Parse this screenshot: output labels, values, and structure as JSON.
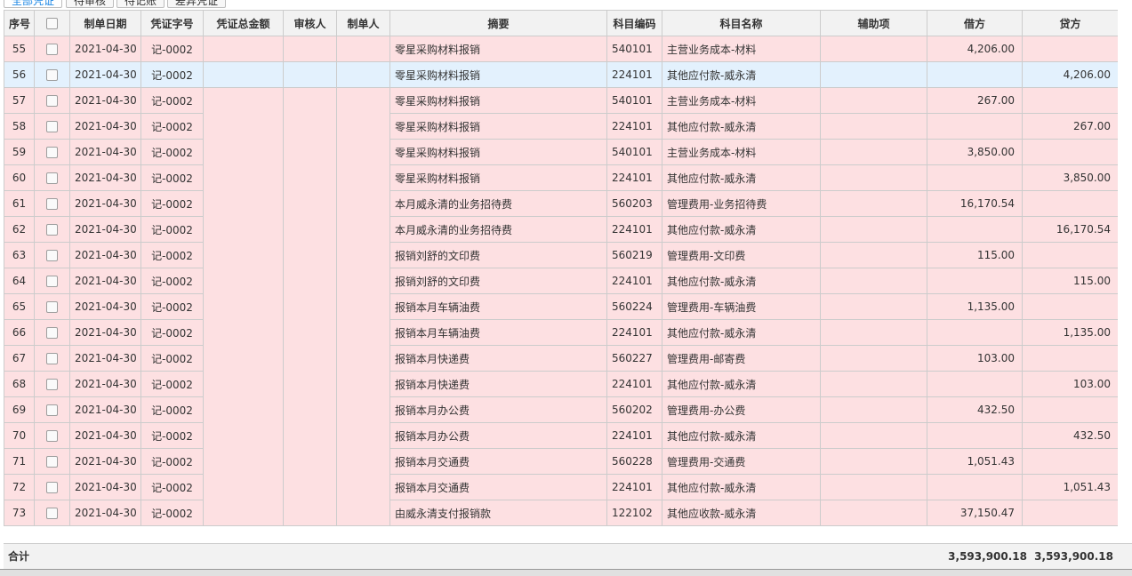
{
  "tabs": [
    "全部凭证",
    "待审核",
    "待记账",
    "差异凭证"
  ],
  "columns": {
    "seq": "序号",
    "date": "制单日期",
    "voucher_no": "凭证字号",
    "total": "凭证总金额",
    "reviewer": "审核人",
    "maker": "制单人",
    "summary": "摘要",
    "account_code": "科目编码",
    "account_name": "科目名称",
    "aux": "辅助项",
    "debit": "借方",
    "credit": "贷方"
  },
  "rows": [
    {
      "seq": "55",
      "date": "2021-04-30",
      "voucher": "记-0002",
      "summary": "零星采购材料报销",
      "code": "540101",
      "name": "主营业务成本-材料",
      "debit": "4,206.00",
      "credit": ""
    },
    {
      "seq": "56",
      "date": "2021-04-30",
      "voucher": "记-0002",
      "summary": "零星采购材料报销",
      "code": "224101",
      "name": "其他应付款-威永清",
      "debit": "",
      "credit": "4,206.00"
    },
    {
      "seq": "57",
      "date": "2021-04-30",
      "voucher": "记-0002",
      "summary": "零星采购材料报销",
      "code": "540101",
      "name": "主营业务成本-材料",
      "debit": "267.00",
      "credit": ""
    },
    {
      "seq": "58",
      "date": "2021-04-30",
      "voucher": "记-0002",
      "summary": "零星采购材料报销",
      "code": "224101",
      "name": "其他应付款-威永清",
      "debit": "",
      "credit": "267.00"
    },
    {
      "seq": "59",
      "date": "2021-04-30",
      "voucher": "记-0002",
      "summary": "零星采购材料报销",
      "code": "540101",
      "name": "主营业务成本-材料",
      "debit": "3,850.00",
      "credit": ""
    },
    {
      "seq": "60",
      "date": "2021-04-30",
      "voucher": "记-0002",
      "summary": "零星采购材料报销",
      "code": "224101",
      "name": "其他应付款-威永清",
      "debit": "",
      "credit": "3,850.00"
    },
    {
      "seq": "61",
      "date": "2021-04-30",
      "voucher": "记-0002",
      "summary": "本月威永清的业务招待费",
      "code": "560203",
      "name": "管理费用-业务招待费",
      "debit": "16,170.54",
      "credit": ""
    },
    {
      "seq": "62",
      "date": "2021-04-30",
      "voucher": "记-0002",
      "summary": "本月威永清的业务招待费",
      "code": "224101",
      "name": "其他应付款-威永清",
      "debit": "",
      "credit": "16,170.54"
    },
    {
      "seq": "63",
      "date": "2021-04-30",
      "voucher": "记-0002",
      "summary": "报销刘舒的文印费",
      "code": "560219",
      "name": "管理费用-文印费",
      "debit": "115.00",
      "credit": ""
    },
    {
      "seq": "64",
      "date": "2021-04-30",
      "voucher": "记-0002",
      "summary": "报销刘舒的文印费",
      "code": "224101",
      "name": "其他应付款-威永清",
      "debit": "",
      "credit": "115.00"
    },
    {
      "seq": "65",
      "date": "2021-04-30",
      "voucher": "记-0002",
      "summary": "报销本月车辆油费",
      "code": "560224",
      "name": "管理费用-车辆油费",
      "debit": "1,135.00",
      "credit": ""
    },
    {
      "seq": "66",
      "date": "2021-04-30",
      "voucher": "记-0002",
      "summary": "报销本月车辆油费",
      "code": "224101",
      "name": "其他应付款-威永清",
      "debit": "",
      "credit": "1,135.00"
    },
    {
      "seq": "67",
      "date": "2021-04-30",
      "voucher": "记-0002",
      "summary": "报销本月快递费",
      "code": "560227",
      "name": "管理费用-邮寄费",
      "debit": "103.00",
      "credit": ""
    },
    {
      "seq": "68",
      "date": "2021-04-30",
      "voucher": "记-0002",
      "summary": "报销本月快递费",
      "code": "224101",
      "name": "其他应付款-威永清",
      "debit": "",
      "credit": "103.00"
    },
    {
      "seq": "69",
      "date": "2021-04-30",
      "voucher": "记-0002",
      "summary": "报销本月办公费",
      "code": "560202",
      "name": "管理费用-办公费",
      "debit": "432.50",
      "credit": ""
    },
    {
      "seq": "70",
      "date": "2021-04-30",
      "voucher": "记-0002",
      "summary": "报销本月办公费",
      "code": "224101",
      "name": "其他应付款-威永清",
      "debit": "",
      "credit": "432.50"
    },
    {
      "seq": "71",
      "date": "2021-04-30",
      "voucher": "记-0002",
      "summary": "报销本月交通费",
      "code": "560228",
      "name": "管理费用-交通费",
      "debit": "1,051.43",
      "credit": ""
    },
    {
      "seq": "72",
      "date": "2021-04-30",
      "voucher": "记-0002",
      "summary": "报销本月交通费",
      "code": "224101",
      "name": "其他应付款-威永清",
      "debit": "",
      "credit": "1,051.43"
    },
    {
      "seq": "73",
      "date": "2021-04-30",
      "voucher": "记-0002",
      "summary": "由威永清支付报销款",
      "code": "122102",
      "name": "其他应收款-威永清",
      "debit": "37,150.47",
      "credit": ""
    }
  ],
  "footer": {
    "label": "合计",
    "debit_total": "3,593,900.18",
    "credit_total": "3,593,900.18"
  },
  "colors": {
    "row_bg": "#fde0e2",
    "selected_bg": "#e3f1fd",
    "header_bg": "#f2f2f2",
    "accent": "#1e88e5"
  }
}
